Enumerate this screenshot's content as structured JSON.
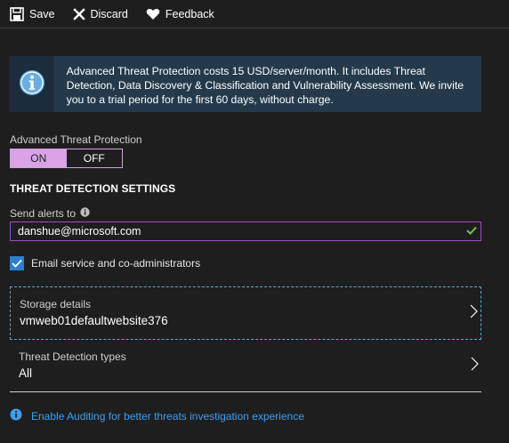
{
  "toolbar": {
    "save_label": "Save",
    "discard_label": "Discard",
    "feedback_label": "Feedback"
  },
  "banner": {
    "text": "Advanced Threat Protection costs 15 USD/server/month. It includes Threat Detection, Data Discovery & Classification and Vulnerability Assessment. We invite you to a trial period for the first 60 days, without charge.",
    "icon": "info-icon"
  },
  "atp": {
    "label": "Advanced Threat Protection",
    "on_label": "ON",
    "off_label": "OFF",
    "selected": "ON",
    "accent_color": "#d9a3e6"
  },
  "settings": {
    "title": "THREAT DETECTION SETTINGS",
    "send_alerts_label": "Send alerts to",
    "email_value": "danshue@microsoft.com",
    "email_checkbox_label": "Email service and co-administrators",
    "email_checkbox_checked": true
  },
  "storage": {
    "label": "Storage details",
    "value": "vmweb01defaultwebsite376"
  },
  "detection_types": {
    "label": "Threat Detection types",
    "value": "All"
  },
  "auditing": {
    "link_text": "Enable Auditing for better threats investigation experience",
    "link_color": "#3aa0f3"
  }
}
